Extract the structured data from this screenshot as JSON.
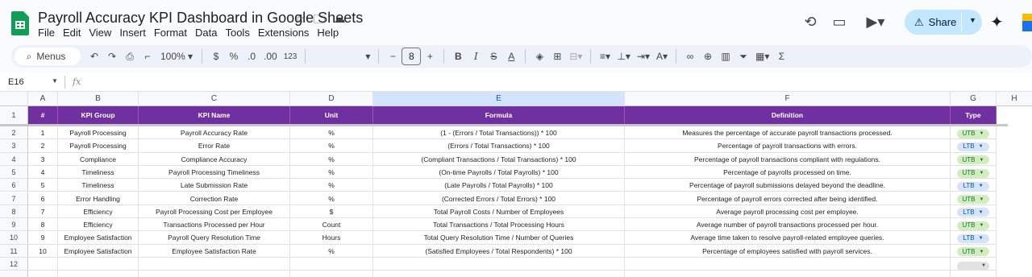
{
  "app": {
    "title": "Payroll Accuracy KPI Dashboard in Google Sheets",
    "menu": [
      "File",
      "Edit",
      "View",
      "Insert",
      "Format",
      "Data",
      "Tools",
      "Extensions",
      "Help"
    ],
    "share_label": "Share"
  },
  "toolbar": {
    "menus_label": "Menus",
    "zoom": "100%",
    "currency": "$",
    "percent": "%",
    "dec_decrease": ".0",
    "dec_increase": ".00",
    "number_format": "123",
    "font_size": "8"
  },
  "formula_bar": {
    "cell_ref": "E16",
    "fx": "fx"
  },
  "columns": [
    "A",
    "B",
    "C",
    "D",
    "E",
    "F",
    "G",
    "H"
  ],
  "header_row": {
    "num": "#",
    "kpi_group": "KPI Group",
    "kpi_name": "KPI Name",
    "unit": "Unit",
    "formula": "Formula",
    "definition": "Definition",
    "type": "Type"
  },
  "rows": [
    {
      "num": "1",
      "group": "Payroll Processing",
      "name": "Payroll Accuracy Rate",
      "unit": "%",
      "formula": "(1 - (Errors / Total Transactions)) * 100",
      "definition": "Measures the percentage of accurate payroll transactions processed.",
      "type": "UTB"
    },
    {
      "num": "2",
      "group": "Payroll Processing",
      "name": "Error Rate",
      "unit": "%",
      "formula": "(Errors / Total Transactions) * 100",
      "definition": "Percentage of payroll transactions with errors.",
      "type": "LTB"
    },
    {
      "num": "3",
      "group": "Compliance",
      "name": "Compliance Accuracy",
      "unit": "%",
      "formula": "(Compliant Transactions / Total Transactions) * 100",
      "definition": "Percentage of payroll transactions compliant with regulations.",
      "type": "UTB"
    },
    {
      "num": "4",
      "group": "Timeliness",
      "name": "Payroll Processing Timeliness",
      "unit": "%",
      "formula": "(On-time Payrolls / Total Payrolls) * 100",
      "definition": "Percentage of payrolls processed on time.",
      "type": "UTB"
    },
    {
      "num": "5",
      "group": "Timeliness",
      "name": "Late Submission Rate",
      "unit": "%",
      "formula": "(Late Payrolls / Total Payrolls) * 100",
      "definition": "Percentage of payroll submissions delayed beyond the deadline.",
      "type": "LTB"
    },
    {
      "num": "6",
      "group": "Error Handling",
      "name": "Correction Rate",
      "unit": "%",
      "formula": "(Corrected Errors / Total Errors) * 100",
      "definition": "Percentage of payroll errors corrected after being identified.",
      "type": "UTB"
    },
    {
      "num": "7",
      "group": "Efficiency",
      "name": "Payroll Processing Cost per Employee",
      "unit": "$",
      "formula": "Total Payroll Costs / Number of Employees",
      "definition": "Average payroll processing cost per employee.",
      "type": "LTB"
    },
    {
      "num": "8",
      "group": "Efficiency",
      "name": "Transactions Processed per Hour",
      "unit": "Count",
      "formula": "Total Transactions / Total Processing Hours",
      "definition": "Average number of payroll transactions processed per hour.",
      "type": "UTB"
    },
    {
      "num": "9",
      "group": "Employee Satisfaction",
      "name": "Payroll Query Resolution Time",
      "unit": "Hours",
      "formula": "Total Query Resolution Time / Number of Queries",
      "definition": "Average time taken to resolve payroll-related employee queries.",
      "type": "LTB"
    },
    {
      "num": "10",
      "group": "Employee Satisfaction",
      "name": "Employee Satisfaction Rate",
      "unit": "%",
      "formula": "(Satisfied Employees / Total Respondents) * 100",
      "definition": "Percentage of employees satisfied with payroll services.",
      "type": "UTB"
    }
  ],
  "row_numbers": [
    "1",
    "2",
    "3",
    "4",
    "5",
    "6",
    "7",
    "8",
    "9",
    "10",
    "11",
    "12"
  ],
  "colors": {
    "header_purple": "#7030a0",
    "utb_bg": "#d4edbc",
    "ltb_bg": "#d6e4f7",
    "share_bg": "#c2e7ff",
    "sheets_green": "#0f9d58"
  }
}
